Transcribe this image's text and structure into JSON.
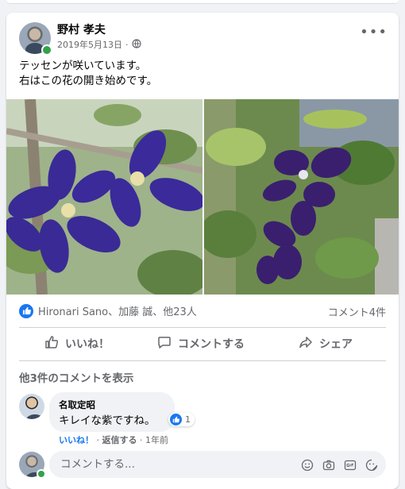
{
  "post": {
    "author": "野村 孝夫",
    "date": "2019年5月13日",
    "separator": "·",
    "privacy_icon": "globe-icon",
    "text": "テッセンが咲いています。\n右はこの花の開き始めです。",
    "photos": [
      "clematis-flowers-open",
      "clematis-flower-opening"
    ]
  },
  "reactions": {
    "summary": "Hironari Sano、加藤 誠、他23人",
    "comment_count": "コメント4件"
  },
  "actions": {
    "like": "いいね！",
    "comment": "コメントする",
    "share": "シェア"
  },
  "comments": {
    "view_more": "他3件のコメントを表示",
    "items": [
      {
        "name": "名取定昭",
        "text": "キレイな紫ですね。",
        "reaction_count": "1",
        "like": "いいね！",
        "dot": "·",
        "reply": "返信する",
        "time": "1年前"
      }
    ]
  },
  "composer": {
    "placeholder": "コメントする..."
  },
  "colors": {
    "accent": "#1877f2",
    "secondary_text": "#65676b",
    "online": "#31a24c"
  }
}
